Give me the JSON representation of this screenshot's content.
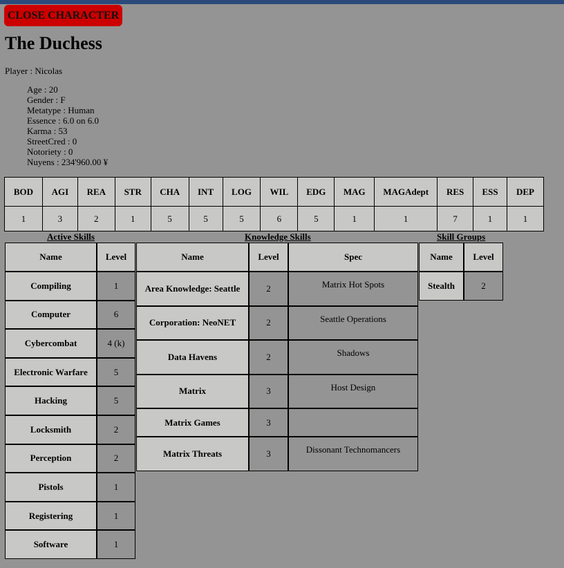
{
  "topbar_color": "#2b4a7a",
  "close_button": {
    "label": "CLOSE CHARACTER",
    "color": "#cc0000"
  },
  "character": {
    "name": "The Duchess",
    "player": "Player : Nicolas",
    "info": [
      "Age : 20",
      "Gender : F",
      "Metatype : Human",
      "Essence : 6.0 on 6.0",
      "Karma : 53",
      "StreetCred : 0",
      "Notoriety : 0",
      "Nuyens : 234'960.00 ¥"
    ]
  },
  "attributes": {
    "headers": [
      "BOD",
      "AGI",
      "REA",
      "STR",
      "CHA",
      "INT",
      "LOG",
      "WIL",
      "EDG",
      "MAG",
      "MAGAdept",
      "RES",
      "ESS",
      "DEP"
    ],
    "values": [
      "1",
      "3",
      "2",
      "1",
      "5",
      "5",
      "5",
      "6",
      "5",
      "1",
      "1",
      "7",
      "1",
      "1"
    ]
  },
  "active_skills": {
    "title": "Active Skills",
    "headers": {
      "name": "Name",
      "level": "Level"
    },
    "rows": [
      {
        "name": "Compiling",
        "level": "1"
      },
      {
        "name": "Computer",
        "level": "6"
      },
      {
        "name": "Cybercombat",
        "level": "4 (k)"
      },
      {
        "name": "Electronic Warfare",
        "level": "5"
      },
      {
        "name": "Hacking",
        "level": "5"
      },
      {
        "name": "Locksmith",
        "level": "2"
      },
      {
        "name": "Perception",
        "level": "2"
      },
      {
        "name": "Pistols",
        "level": "1"
      },
      {
        "name": "Registering",
        "level": "1"
      },
      {
        "name": "Software",
        "level": "1"
      }
    ]
  },
  "knowledge_skills": {
    "title": "Knowledge Skills",
    "headers": {
      "name": "Name",
      "level": "Level",
      "spec": "Spec"
    },
    "rows": [
      {
        "name": "Area Knowledge: Seattle",
        "level": "2",
        "spec": "Matrix Hot Spots"
      },
      {
        "name": "Corporation: NeoNET",
        "level": "2",
        "spec": "Seattle Operations"
      },
      {
        "name": "Data Havens",
        "level": "2",
        "spec": "Shadows"
      },
      {
        "name": "Matrix",
        "level": "3",
        "spec": "Host Design"
      },
      {
        "name": "Matrix Games",
        "level": "3",
        "spec": ""
      },
      {
        "name": "Matrix Threats",
        "level": "3",
        "spec": "Dissonant Technomancers"
      }
    ]
  },
  "skill_groups": {
    "title": "Skill Groups",
    "headers": {
      "name": "Name",
      "level": "Level"
    },
    "rows": [
      {
        "name": "Stealth",
        "level": "2"
      }
    ]
  }
}
